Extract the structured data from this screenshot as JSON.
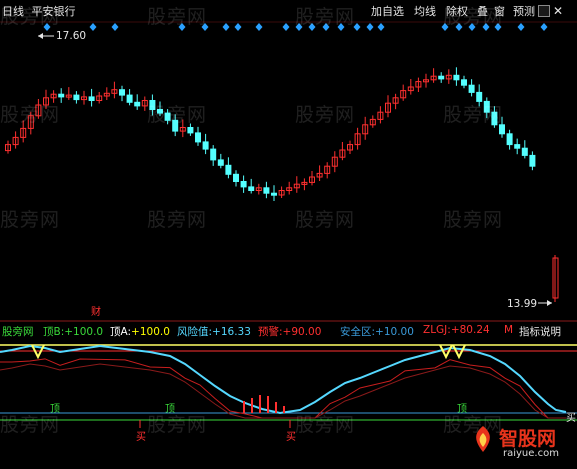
{
  "header": {
    "period": "日线",
    "stock_name": "平安银行"
  },
  "toolbar": [
    {
      "label": "加自选"
    },
    {
      "label": "均线"
    },
    {
      "label": "除权"
    },
    {
      "label": "叠"
    },
    {
      "label": "窗"
    },
    {
      "label": "预测"
    }
  ],
  "price_panel": {
    "high_marker": "17.60",
    "low_marker": "13.99",
    "finance_tag": "财"
  },
  "indicator_bar": {
    "name": "股旁网",
    "items": [
      {
        "label": "顶B:",
        "value": "+100.0",
        "color": "#ffff00",
        "label_color": "#ffffff"
      },
      {
        "label": "顶A:",
        "value": "+100.0",
        "color": "#ffff00",
        "label_color": "#ffffff"
      },
      {
        "label": "风险值:",
        "value": "+16.33",
        "color": "#55d8ff",
        "label_color": "#55d8ff"
      },
      {
        "label": "预警:",
        "value": "+90.00",
        "color": "#ff3030",
        "label_color": "#ff3030"
      },
      {
        "label": "安全区:",
        "value": "+10.00",
        "color": "#3a9ad9",
        "label_color": "#3a9ad9"
      },
      {
        "label": "ZLGJ:",
        "value": "+80.24",
        "color": "#ff3030",
        "label_color": "#ff3030"
      }
    ],
    "extra_mark": "M",
    "help_button": "指标说明"
  },
  "signals": {
    "buy": "买",
    "top": "顶"
  },
  "watermarks": [
    "股旁网",
    "股旁网",
    "股旁网",
    "股旁网",
    "股旁网",
    "股旁网",
    "股旁网",
    "股旁网",
    "股旁网",
    "股旁网",
    "股旁网",
    "股旁网",
    "股旁网",
    "股旁网",
    "股旁网",
    "股旁网"
  ],
  "brand": {
    "name": "智股网",
    "url": "raiyue.com"
  },
  "colors": {
    "background": "#000000",
    "up_candle": "#ff3030",
    "down_candle": "#54ffff",
    "risk_line": "#55d8ff",
    "warning_line": "#ff3030",
    "top_line": "#ffff66",
    "safe_line": "#3a9ad9"
  }
}
